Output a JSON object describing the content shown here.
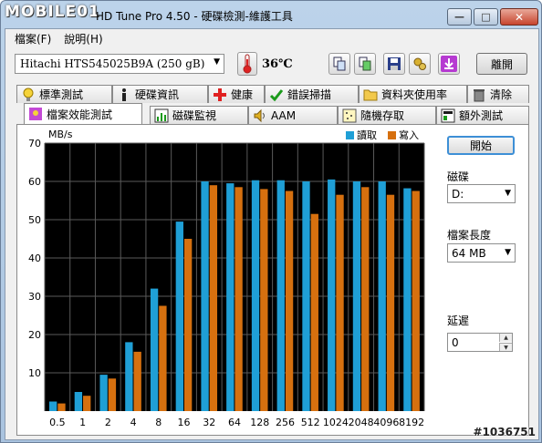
{
  "window": {
    "logo_text": "MOBILE01",
    "title": "HD Tune Pro 4.50 - 硬碟檢測-維護工具",
    "min_glyph": "—",
    "max_glyph": "□",
    "close_glyph": "✕"
  },
  "menu": [
    {
      "label": "檔案(F)"
    },
    {
      "label": "說明(H)"
    }
  ],
  "toolbar": {
    "drive": "Hitachi HTS545025B9A     (250 gB)",
    "temperature": "36℃",
    "exit_label": "離開",
    "buttons": [
      {
        "name": "copy-text-button",
        "icon": "copy-icon"
      },
      {
        "name": "copy-screenshot-button",
        "icon": "screenshot-icon"
      },
      {
        "name": "save-button",
        "icon": "floppy-icon"
      },
      {
        "name": "options-button",
        "icon": "options-icon"
      },
      {
        "name": "download-button",
        "icon": "download-arrow-icon"
      }
    ]
  },
  "tabs_row1": [
    {
      "label": "標準測試",
      "icon": "bulb-icon"
    },
    {
      "label": "硬碟資訊",
      "icon": "info-icon"
    },
    {
      "label": "健康",
      "icon": "health-cross-icon"
    },
    {
      "label": "錯誤掃描",
      "icon": "scan-icon"
    },
    {
      "label": "資料夾使用率",
      "icon": "folder-icon"
    },
    {
      "label": "清除",
      "icon": "trash-icon"
    }
  ],
  "tabs_row2": [
    {
      "label": "檔案效能測試",
      "icon": "file-benchmark-icon",
      "active": true
    },
    {
      "label": "磁碟監視",
      "icon": "monitor-icon"
    },
    {
      "label": "AAM",
      "icon": "speaker-icon"
    },
    {
      "label": "隨機存取",
      "icon": "random-access-icon"
    },
    {
      "label": "額外測試",
      "icon": "extra-tests-icon"
    }
  ],
  "controls": {
    "start_label": "開始",
    "disk_label": "磁碟",
    "disk_value": "D:",
    "file_length_label": "檔案長度",
    "file_length_value": "64 MB",
    "delay_label": "延遲",
    "delay_value": "0"
  },
  "colors": {
    "read": "#1f9fd6",
    "write": "#d6700f",
    "plot_bg": "#000000",
    "grid": "#5a5a5a"
  },
  "watermark": "#1036751",
  "chart_data": {
    "type": "bar",
    "ylabel": "MB/s",
    "ylim": [
      0,
      70
    ],
    "yticks": [
      10,
      20,
      30,
      40,
      50,
      60,
      70
    ],
    "categories": [
      "0.5",
      "1",
      "2",
      "4",
      "8",
      "16",
      "32",
      "64",
      "128",
      "256",
      "512",
      "1024",
      "2048",
      "4096",
      "8192"
    ],
    "series": [
      {
        "name": "讀取",
        "values": [
          2.5,
          5,
          9.5,
          18,
          32,
          49.5,
          60,
          59.5,
          60.3,
          60.3,
          60,
          60.5,
          60,
          60,
          58.2
        ]
      },
      {
        "name": "寫入",
        "values": [
          2,
          4,
          8.5,
          15.5,
          27.5,
          45,
          59,
          58.5,
          58,
          57.5,
          51.5,
          56.5,
          58.5,
          56.5,
          57.5
        ]
      }
    ],
    "grid": true,
    "legend": "top-right"
  }
}
